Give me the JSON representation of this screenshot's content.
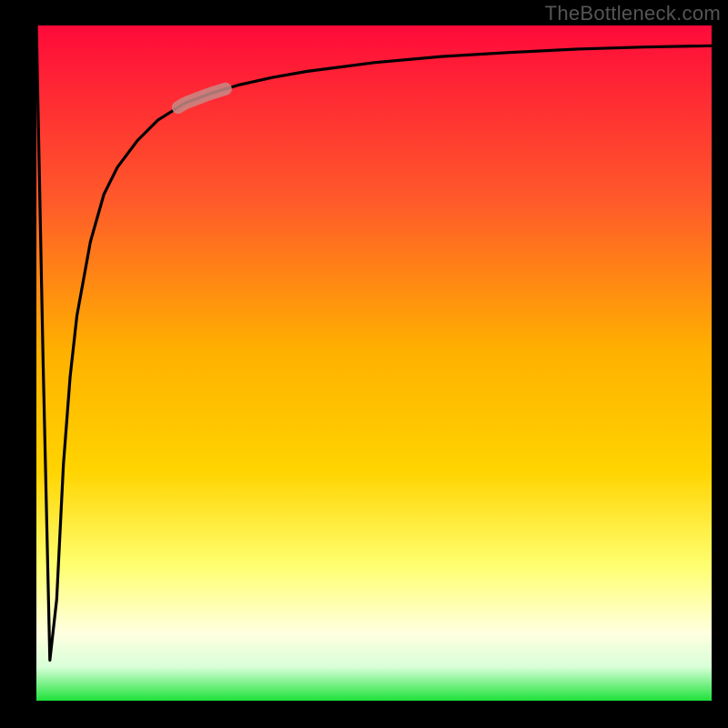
{
  "watermark": "TheBottleneck.com",
  "colors": {
    "background": "#000000",
    "gradient_top": "#ff0a3a",
    "gradient_mid_upper": "#ff7a1a",
    "gradient_mid": "#ffd400",
    "gradient_lower": "#ffff66",
    "gradient_pale": "#ffffd0",
    "gradient_bottom": "#1de23a",
    "curve": "#000000",
    "marker": "#c78a86"
  },
  "chart_data": {
    "type": "line",
    "title": "",
    "xlabel": "",
    "ylabel": "",
    "xlim": [
      0,
      100
    ],
    "ylim": [
      0,
      100
    ],
    "grid": false,
    "legend": false,
    "series": [
      {
        "name": "bottleneck-curve",
        "x": [
          0,
          1,
          2,
          3,
          4,
          5,
          6,
          8,
          10,
          12,
          15,
          18,
          22,
          26,
          30,
          35,
          40,
          50,
          60,
          70,
          80,
          90,
          100
        ],
        "y": [
          100,
          50,
          6,
          15,
          35,
          48,
          57,
          68,
          75,
          79,
          83,
          86,
          88.5,
          90,
          91.2,
          92.3,
          93.2,
          94.5,
          95.4,
          96,
          96.5,
          96.8,
          97
        ]
      }
    ],
    "annotations": [
      {
        "name": "highlight-segment",
        "x_range": [
          21,
          28
        ],
        "note": "pale marker on curve"
      }
    ],
    "background_gradient": {
      "direction": "vertical",
      "stops": [
        {
          "pos": 0.0,
          "value": "high"
        },
        {
          "pos": 0.5,
          "value": "mid"
        },
        {
          "pos": 0.9,
          "value": "low-warn"
        },
        {
          "pos": 1.0,
          "value": "ok"
        }
      ]
    }
  }
}
